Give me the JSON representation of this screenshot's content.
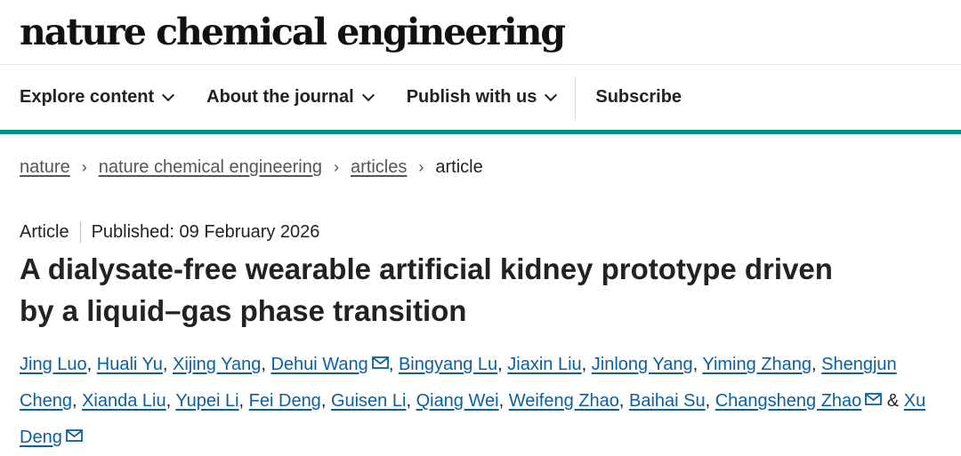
{
  "masthead": {
    "logo": "nature chemical engineering"
  },
  "nav": {
    "items": [
      {
        "label": "Explore content"
      },
      {
        "label": "About the journal"
      },
      {
        "label": "Publish with us"
      }
    ],
    "subscribe": "Subscribe"
  },
  "breadcrumbs": {
    "items": [
      "nature",
      "nature chemical engineering",
      "articles"
    ],
    "separator": "›",
    "current": "article"
  },
  "article": {
    "type": "Article",
    "published": "Published: 09 February 2026",
    "title": "A dialysate-free wearable artificial kidney prototype driven by a liquid–gas phase transition",
    "authors": [
      {
        "name": "Jing Luo",
        "sep": ", "
      },
      {
        "name": "Huali Yu",
        "sep": ", "
      },
      {
        "name": "Xijing Yang",
        "sep": ", "
      },
      {
        "name": "Dehui Wang",
        "mail": true,
        "sep": ", "
      },
      {
        "name": "Bingyang Lu",
        "sep": ", "
      },
      {
        "name": "Jiaxin Liu",
        "sep": ", "
      },
      {
        "name": "Jinlong Yang",
        "sep": ", "
      },
      {
        "name": "Yiming Zhang",
        "sep": ", "
      },
      {
        "name": "Shengjun Cheng",
        "sep": ", "
      },
      {
        "name": "Xianda Liu",
        "sep": ", "
      },
      {
        "name": "Yupei Li",
        "sep": ", "
      },
      {
        "name": "Fei Deng",
        "sep": ", "
      },
      {
        "name": "Guisen Li",
        "sep": ", "
      },
      {
        "name": "Qiang Wei",
        "sep": ", "
      },
      {
        "name": "Weifeng Zhao",
        "sep": ", "
      },
      {
        "name": "Baihai Su",
        "sep": ", "
      },
      {
        "name": "Changsheng Zhao",
        "mail": true,
        "sep": " & "
      },
      {
        "name": "Xu Deng",
        "mail": true,
        "sep": ""
      }
    ]
  },
  "colors": {
    "accent": "#008f8a",
    "link": "#0b5f9f"
  },
  "icons": {
    "dropdown": "chevron-down-icon",
    "email": "mail-icon"
  }
}
